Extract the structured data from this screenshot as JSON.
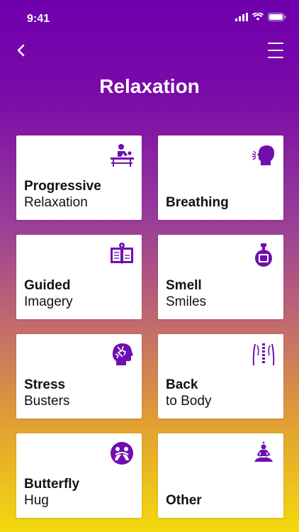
{
  "status": {
    "time": "9:41"
  },
  "header": {
    "title": "Relaxation"
  },
  "colors": {
    "accent": "#6f0fb0",
    "gradient_top": "#6f00ad",
    "gradient_bottom": "#f3d90e"
  },
  "cards": [
    {
      "line1": "Progressive",
      "line2": "Relaxation",
      "icon": "massage-icon"
    },
    {
      "line1": "Breathing",
      "line2": "",
      "icon": "breathing-head-icon"
    },
    {
      "line1": "Guided",
      "line2": "Imagery",
      "icon": "book-icon"
    },
    {
      "line1": "Smell",
      "line2": "Smiles",
      "icon": "perfume-bottle-icon"
    },
    {
      "line1": "Stress",
      "line2": "Busters",
      "icon": "stressed-head-icon"
    },
    {
      "line1": "Back",
      "line2": "to Body",
      "icon": "spine-back-icon"
    },
    {
      "line1": "Butterfly",
      "line2": "Hug",
      "icon": "butterfly-hug-icon"
    },
    {
      "line1": "Other",
      "line2": "",
      "icon": "meditation-icon"
    }
  ]
}
